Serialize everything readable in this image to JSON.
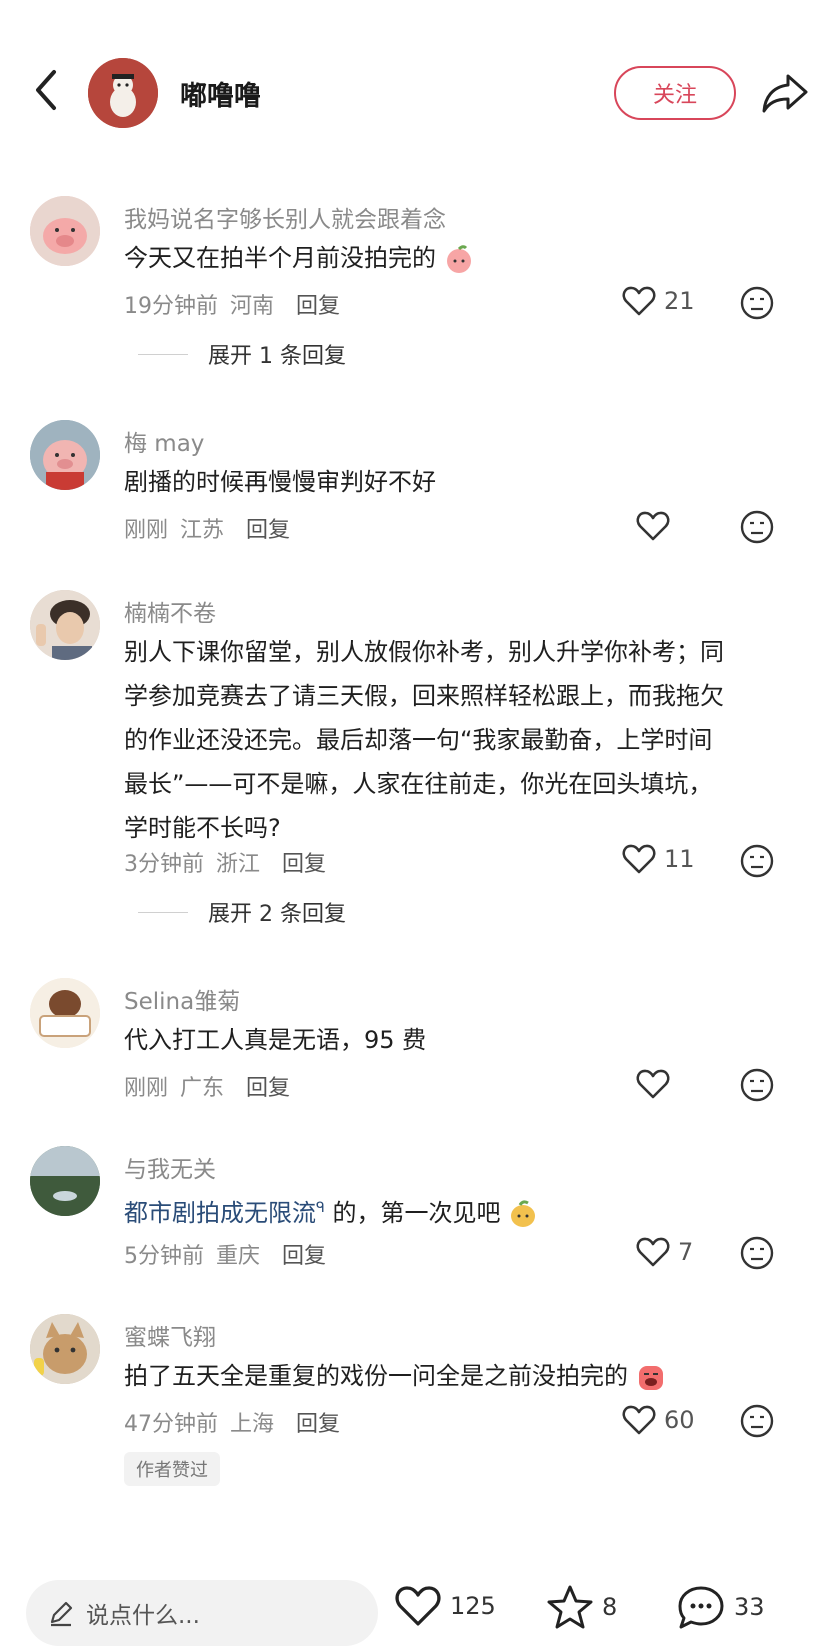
{
  "header": {
    "username": "嘟噜噜",
    "follow_label": "关注"
  },
  "comments": [
    {
      "author": "我妈说名字够长别人就会跟着念",
      "lines": [
        "今天又在拍半个月前没拍完的"
      ],
      "time": "19分钟前",
      "location": "河南",
      "reply_label": "回复",
      "likes": "21",
      "expand_label": "展开 1 条回复",
      "avatar_color": "#f0c9c3"
    },
    {
      "author": "梅 may",
      "lines": [
        "剧播的时候再慢慢审判好不好"
      ],
      "time": "刚刚",
      "location": "江苏",
      "reply_label": "回复",
      "likes": "",
      "avatar_color": "#8da5b3"
    },
    {
      "author": "楠楠不卷",
      "lines": [
        "别人下课你留堂，别人放假你补考，别人升学你补考；同",
        "学参加竞赛去了请三天假，回来照样轻松跟上，而我拖欠",
        "的作业还没还完。最后却落一句“我家最勤奋，上学时间",
        "最长”——可不是嘛，人家在往前走，你光在回头填坑，",
        "学时能不长吗?"
      ],
      "time": "3分钟前",
      "location": "浙江",
      "reply_label": "回复",
      "likes": "11",
      "expand_label": "展开 2 条回复",
      "avatar_color": "#d4c4b7"
    },
    {
      "author": "Selina雏菊",
      "lines": [
        "代入打工人真是无语，95 费"
      ],
      "time": "刚刚",
      "location": "广东",
      "reply_label": "回复",
      "likes": "",
      "avatar_color": "#f3e7d6"
    },
    {
      "author": "与我无关",
      "link_text": "都市剧拍成无限流",
      "link_suffix": "的，第一次见吧",
      "time": "5分钟前",
      "location": "重庆",
      "reply_label": "回复",
      "likes": "7",
      "avatar_color": "#4d6a4c"
    },
    {
      "author": "蜜蝶飞翔",
      "lines": [
        "拍了五天全是重复的戏份一问全是之前没拍完的"
      ],
      "time": "47分钟前",
      "location": "上海",
      "reply_label": "回复",
      "likes": "60",
      "badge": "作者赞过",
      "avatar_color": "#c9b89f"
    }
  ],
  "bottom_bar": {
    "input_placeholder": "说点什么...",
    "likes": "125",
    "stars": "8",
    "comments": "33"
  },
  "colors": {
    "accent": "#d8465a",
    "link": "#2a4c78",
    "muted": "#8a8a8a"
  }
}
